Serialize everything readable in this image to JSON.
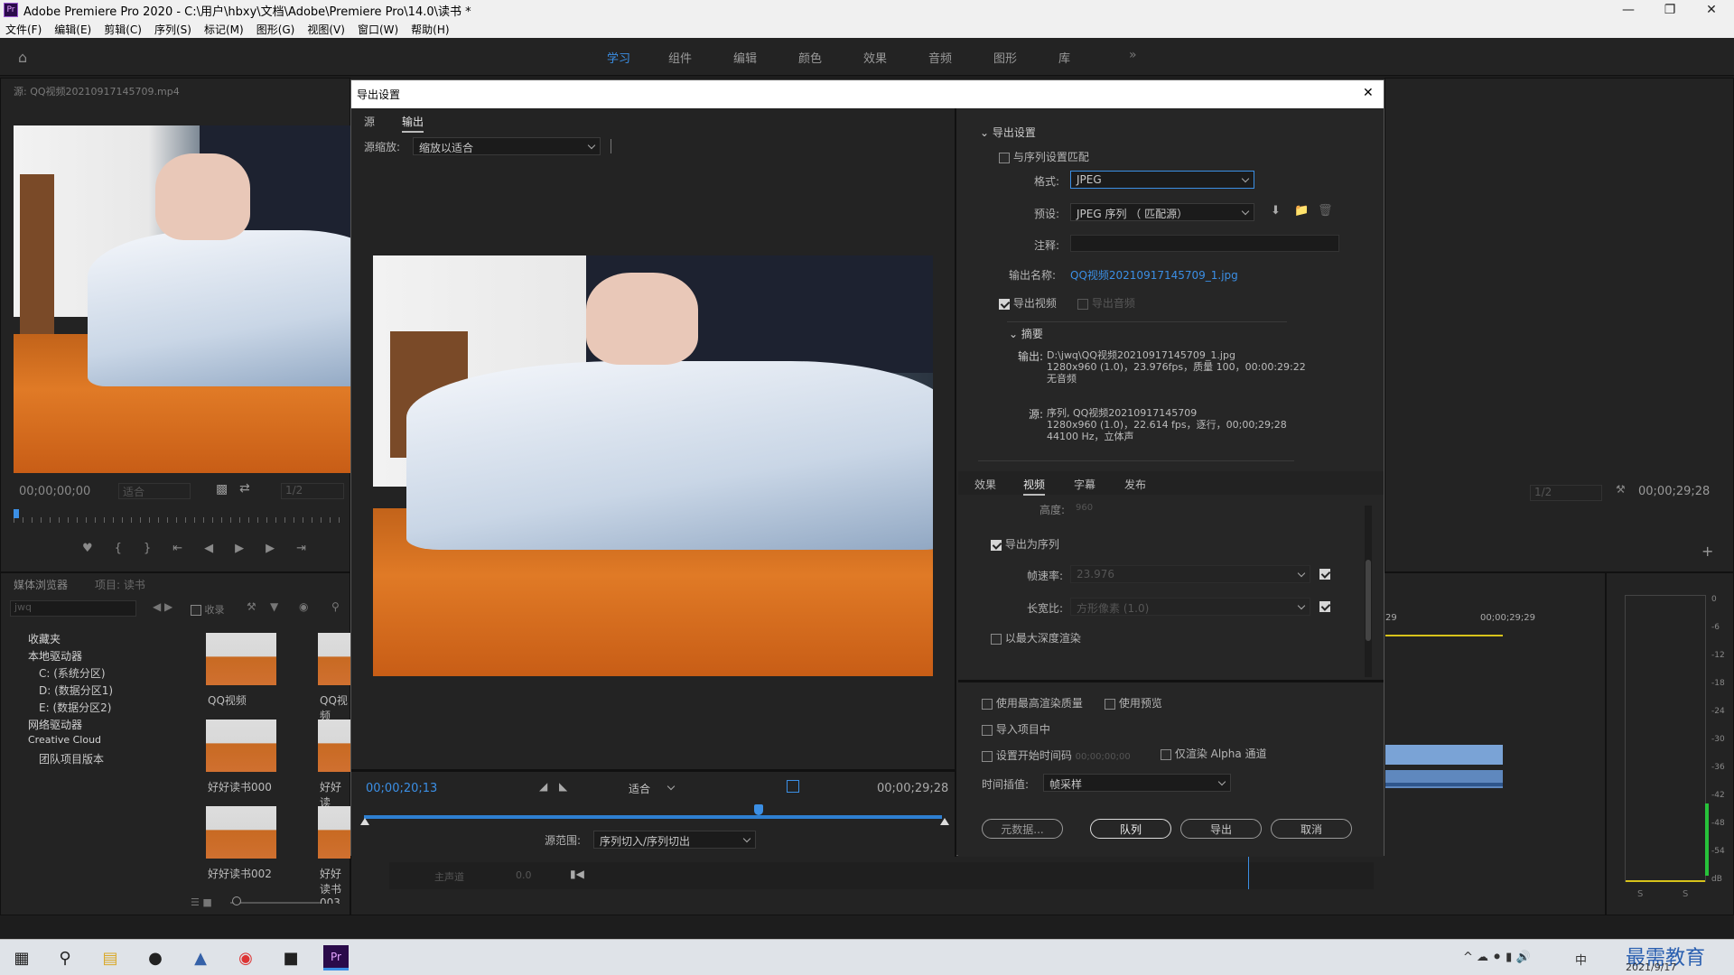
{
  "window": {
    "title": "Adobe Premiere Pro 2020 - C:\\用户\\hbxy\\文档\\Adobe\\Premiere Pro\\14.0\\读书 *",
    "app_badge": "Pr"
  },
  "menu": [
    "文件(F)",
    "编辑(E)",
    "剪辑(C)",
    "序列(S)",
    "标记(M)",
    "图形(G)",
    "视图(V)",
    "窗口(W)",
    "帮助(H)"
  ],
  "workspaces": [
    {
      "label": "学习",
      "active": true
    },
    {
      "label": "组件"
    },
    {
      "label": "编辑"
    },
    {
      "label": "颜色"
    },
    {
      "label": "效果"
    },
    {
      "label": "音频"
    },
    {
      "label": "图形"
    },
    {
      "label": "库"
    }
  ],
  "source_monitor": {
    "tab": "源: QQ视频20210917145709.mp4",
    "timecode": "00;00;00;00",
    "zoom": "适合",
    "quality": "1/2"
  },
  "program_monitor": {
    "quality": "1/2",
    "timecode": "00;00;29;28"
  },
  "project_panel": {
    "tabs": [
      "媒体浏览器",
      "项目: 读书"
    ],
    "search_value": "jwq",
    "ingest_label": "收录",
    "tree": [
      {
        "label": "收藏夹",
        "level": 0
      },
      {
        "label": "本地驱动器",
        "level": 0
      },
      {
        "label": "C: (系统分区)",
        "level": 1
      },
      {
        "label": "D: (数据分区1)",
        "level": 1
      },
      {
        "label": "E: (数据分区2)",
        "level": 1
      },
      {
        "label": "网络驱动器",
        "level": 0
      },
      {
        "label": "Creative Cloud",
        "level": 0
      },
      {
        "label": "团队项目版本",
        "level": 1
      }
    ],
    "thumbs": [
      "QQ视频",
      "QQ视频",
      "好好读书000",
      "好好读",
      "好好读书002",
      "好好读书003"
    ]
  },
  "timeline": {
    "time_labels": [
      "29",
      "00;00;29;29"
    ],
    "track_master": "主声道",
    "track_value": "0.0"
  },
  "meter": {
    "scale": [
      "0",
      "-6",
      "-12",
      "-18",
      "-24",
      "-30",
      "-36",
      "-42",
      "-48",
      "-54",
      "dB"
    ],
    "solo": [
      "S",
      "S"
    ]
  },
  "dialog": {
    "title": "导出设置",
    "close_glyph": "✕",
    "left_tabs": [
      "源",
      "输出"
    ],
    "source_scaling_label": "源缩放:",
    "source_scaling_value": "缩放以适合",
    "timecode_in": "00;00;20;13",
    "timecode_out": "00;00;29;28",
    "fit_value": "适合",
    "source_range_label": "源范围:",
    "source_range_value": "序列切入/序列切出",
    "export_settings_header": "导出设置",
    "match_sequence_label": "与序列设置匹配",
    "format_label": "格式:",
    "format_value": "JPEG",
    "preset_label": "预设:",
    "preset_value": "JPEG 序列 （ 匹配源）",
    "comments_label": "注释:",
    "comments_value": "",
    "output_name_label": "输出名称:",
    "output_name_value": "QQ视频20210917145709_1.jpg",
    "export_video_label": "导出视频",
    "export_audio_label": "导出音频",
    "summary_header": "摘要",
    "summary_output_label": "输出:",
    "summary_output_lines": [
      "D:\\jwq\\QQ视频20210917145709_1.jpg",
      "1280x960 (1.0)，23.976fps，质量 100，00:00:29:22",
      "无音频"
    ],
    "summary_source_label": "源:",
    "summary_source_lines": [
      "序列, QQ视频20210917145709",
      "1280x960 (1.0)，22.614 fps，逐行，00;00;29;28",
      "44100 Hz，立体声"
    ],
    "right_tabs": [
      "效果",
      "视频",
      "字幕",
      "发布"
    ],
    "height_label": "高度:",
    "height_value": "960",
    "export_as_sequence_label": "导出为序列",
    "frame_rate_label": "帧速率:",
    "frame_rate_value": "23.976",
    "aspect_label": "长宽比:",
    "aspect_value": "方形像素 (1.0)",
    "max_depth_label": "以最大深度渲染",
    "max_quality_label": "使用最高渲染质量",
    "use_preview_label": "使用预览",
    "import_label": "导入项目中",
    "start_tc_label": "设置开始时间码",
    "start_tc_value": "00;00;00;00",
    "alpha_label": "仅渲染 Alpha 通道",
    "interp_label": "时间插值:",
    "interp_value": "帧采样",
    "metadata_btn": "元数据...",
    "queue_btn": "队列",
    "export_btn": "导出",
    "cancel_btn": "取消"
  },
  "taskbar": {
    "date": "2021/9/17",
    "watermark": "最需教育",
    "ime": "中"
  }
}
